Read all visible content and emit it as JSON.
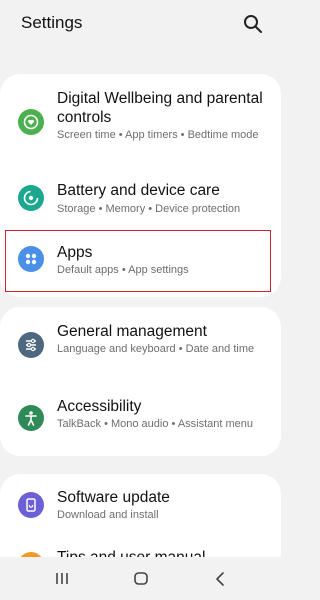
{
  "header": {
    "title": "Settings"
  },
  "items": [
    {
      "title": "Digital Wellbeing and parental controls",
      "subtitle": "Screen time  •  App timers  •  Bedtime mode",
      "icon": "digital-wellbeing-icon",
      "color": "#4caf50"
    },
    {
      "title": "Battery and device care",
      "subtitle": "Storage  •  Memory  •  Device protection",
      "icon": "device-care-icon",
      "color": "#1aa88f"
    },
    {
      "title": "Apps",
      "subtitle": "Default apps  •  App settings",
      "icon": "apps-icon",
      "color": "#4a8fe8"
    },
    {
      "title": "General management",
      "subtitle": "Language and keyboard  •  Date and time",
      "icon": "general-management-icon",
      "color": "#4e6880"
    },
    {
      "title": "Accessibility",
      "subtitle": "TalkBack  •  Mono audio  •  Assistant menu",
      "icon": "accessibility-icon",
      "color": "#2e8b57"
    },
    {
      "title": "Software update",
      "subtitle": "Download and install",
      "icon": "software-update-icon",
      "color": "#6d5fd6"
    },
    {
      "title": "Tips and user manual",
      "subtitle": "",
      "icon": "tips-icon",
      "color": "#f29b24"
    }
  ],
  "nav": {
    "icons": [
      "recents-icon",
      "home-icon",
      "back-icon"
    ]
  },
  "highlight_color": "#c6262c"
}
